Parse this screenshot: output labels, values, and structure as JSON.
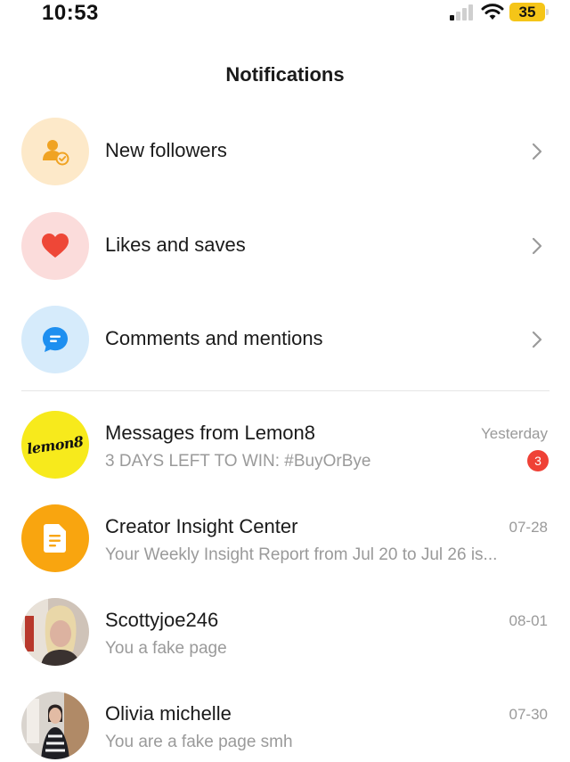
{
  "status_bar": {
    "time": "10:53",
    "battery": "35",
    "colors": {
      "battery": "#f5c518"
    }
  },
  "header": {
    "title": "Notifications"
  },
  "categories": [
    {
      "label": "New followers",
      "icon": "user-check-icon",
      "icon_bg": "#fde9c9",
      "icon_color": "#f0a323"
    },
    {
      "label": "Likes and saves",
      "icon": "heart-icon",
      "icon_bg": "#fbdcdb",
      "icon_color": "#ee4737"
    },
    {
      "label": "Comments and mentions",
      "icon": "chat-bubble-icon",
      "icon_bg": "#d6ebfb",
      "icon_color": "#1e8ff0"
    }
  ],
  "messages": [
    {
      "title": "Messages from Lemon8",
      "preview": "3 DAYS LEFT TO WIN: #BuyOrBye",
      "date": "Yesterday",
      "badge": "3",
      "avatar": "lemon8-logo",
      "logo_text": "lemon8"
    },
    {
      "title": "Creator Insight Center",
      "preview": "Your Weekly Insight Report from Jul 20 to Jul 26 is...",
      "date": "07-28",
      "avatar": "document-icon"
    },
    {
      "title": "Scottyjoe246",
      "preview": "You a fake page",
      "date": "08-01",
      "avatar": "user-photo"
    },
    {
      "title": "Olivia michelle",
      "preview": "You are a fake page smh",
      "date": "07-30",
      "avatar": "user-photo"
    }
  ]
}
